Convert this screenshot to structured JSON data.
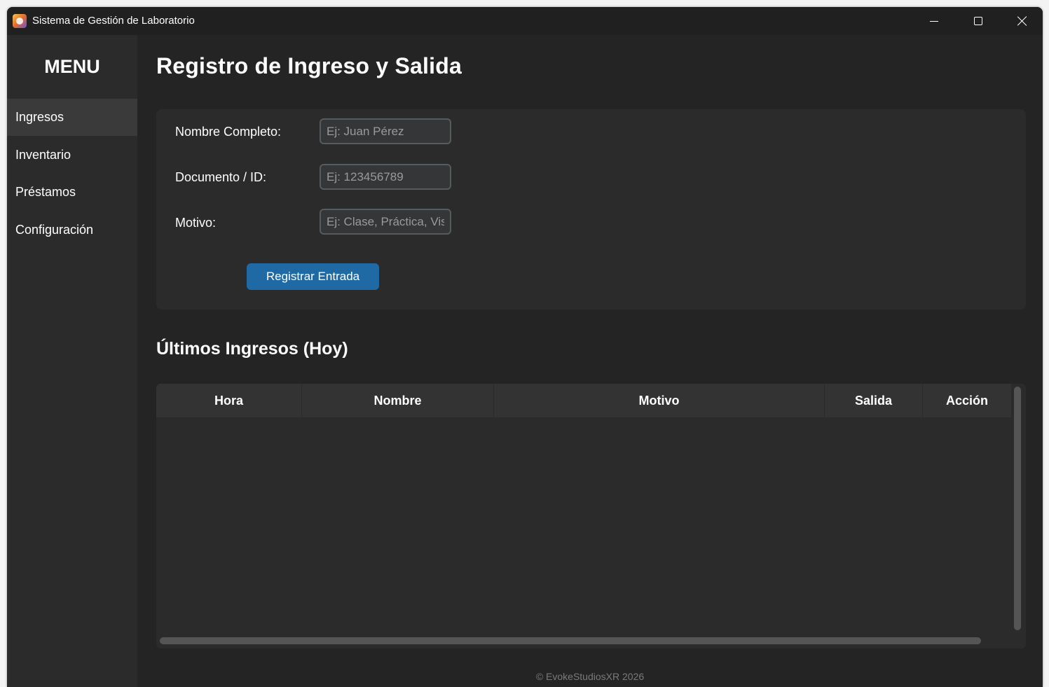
{
  "window": {
    "title": "Sistema de Gestión de Laboratorio",
    "app_icon": "lab-app-icon",
    "controls": {
      "minimize_icon": "minimize-icon",
      "maximize_icon": "maximize-icon",
      "close_icon": "close-icon"
    }
  },
  "sidebar": {
    "title": "MENU",
    "items": [
      {
        "label": "Ingresos",
        "active": true
      },
      {
        "label": "Inventario",
        "active": false
      },
      {
        "label": "Préstamos",
        "active": false
      },
      {
        "label": "Configuración",
        "active": false
      }
    ]
  },
  "main": {
    "title": "Registro de Ingreso y Salida",
    "form": {
      "fields": [
        {
          "label": "Nombre Completo:",
          "placeholder": "Ej: Juan Pérez",
          "value": ""
        },
        {
          "label": "Documento / ID:",
          "placeholder": "Ej: 123456789",
          "value": ""
        },
        {
          "label": "Motivo:",
          "placeholder": "Ej: Clase, Práctica, Visita",
          "value": ""
        }
      ],
      "submit_label": "Registrar Entrada"
    },
    "recent": {
      "title": "Últimos Ingresos (Hoy)",
      "columns": [
        "Hora",
        "Nombre",
        "Motivo",
        "Salida",
        "Acción"
      ],
      "rows": []
    }
  },
  "footer": {
    "text": "© EvokeStudiosXR 2026"
  },
  "colors": {
    "window_bg": "#242424",
    "sidebar_bg": "#2b2b2b",
    "panel_bg": "#2b2b2b",
    "accent": "#1f6aa5",
    "input_bg": "#343638",
    "input_border": "#565b5e"
  }
}
